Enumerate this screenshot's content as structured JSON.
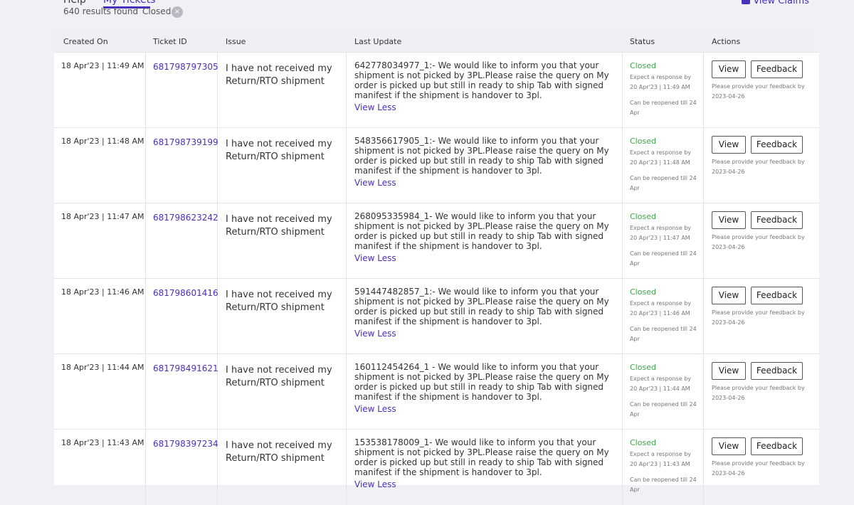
{
  "nav": {
    "tabs": [
      "Help",
      "My Tickets"
    ],
    "active_tab": "My Tickets",
    "results_text": "640 results found",
    "filter_label": "Closed",
    "filter_clear": "×",
    "claims_link": "View Claims",
    "accent_color": "#4a2fbd"
  },
  "table": {
    "headers": [
      "Created On",
      "Ticket ID",
      "Issue",
      "Last Update",
      "Status",
      "Actions"
    ],
    "view_label": "View",
    "feedback_label": "Feedback",
    "view_less_label": "View Less",
    "rows": [
      {
        "created": "18 Apr'23 | 11:49 AM",
        "ticket_id": "681798797305",
        "issue": "I have not received my Return/RTO shipment",
        "update": "642778034977_1:- We would like to inform you that your shipment is not picked by 3PL.Please raise the query on My order is picked up but still in ready to ship Tab with signed manifest if the shipment is handover to 3pl.",
        "status": "Closed",
        "expect_label": "Expect a response by",
        "expect_date": "20 Apr'23 | 11:49 AM",
        "reopen": "Can be reopened till 24 Apr",
        "feedback_note": "Please provide your feedback by 2023-04-26"
      },
      {
        "created": "18 Apr'23 | 11:48 AM",
        "ticket_id": "681798739199",
        "issue": "I have not received my Return/RTO shipment",
        "update": "548356617905_1:- We would like to inform you that your shipment is not picked by 3PL.Please raise the query on My order is picked up but still in ready to ship Tab with signed manifest if the shipment is handover to 3pl.",
        "status": "Closed",
        "expect_label": "Expect a response by",
        "expect_date": "20 Apr'23 | 11:48 AM",
        "reopen": "Can be reopened till 24 Apr",
        "feedback_note": "Please provide your feedback by 2023-04-26"
      },
      {
        "created": "18 Apr'23 | 11:47 AM",
        "ticket_id": "681798623242",
        "issue": "I have not received my Return/RTO shipment",
        "update": "268095335984_1- We would like to inform you that your shipment is not picked by 3PL.Please raise the query on My order is picked up but still in ready to ship Tab with signed manifest if the shipment is handover to 3pl.",
        "status": "Closed",
        "expect_label": "Expect a response by",
        "expect_date": "20 Apr'23 | 11:47 AM",
        "reopen": "Can be reopened till 24 Apr",
        "feedback_note": "Please provide your feedback by 2023-04-26"
      },
      {
        "created": "18 Apr'23 | 11:46 AM",
        "ticket_id": "681798601416",
        "issue": "I have not received my Return/RTO shipment",
        "update": "591447482857_1:- We would like to inform you that your shipment is not picked by 3PL.Please raise the query on My order is picked up but still in ready to ship Tab with signed manifest if the shipment is handover to 3pl.",
        "status": "Closed",
        "expect_label": "Expect a response by",
        "expect_date": "20 Apr'23 | 11:46 AM",
        "reopen": "Can be reopened till 24 Apr",
        "feedback_note": "Please provide your feedback by 2023-04-26"
      },
      {
        "created": "18 Apr'23 | 11:44 AM",
        "ticket_id": "681798491621",
        "issue": "I have not received my Return/RTO shipment",
        "update": "160112454264_1 - We would like to inform you that your shipment is not picked by 3PL.Please raise the query on My order is picked up but still in ready to ship Tab with signed manifest if the shipment is handover to 3pl.",
        "status": "Closed",
        "expect_label": "Expect a response by",
        "expect_date": "20 Apr'23 | 11:44 AM",
        "reopen": "Can be reopened till 24 Apr",
        "feedback_note": "Please provide your feedback by 2023-04-26"
      },
      {
        "created": "18 Apr'23 | 11:43 AM",
        "ticket_id": "681798397234",
        "issue": "I have not received my Return/RTO shipment",
        "update": "153538178009_1- We would like to inform you that your shipment is not picked by 3PL.Please raise the query on My order is picked up but still in ready to ship Tab with signed manifest if the shipment is handover to 3pl.",
        "status": "Closed",
        "expect_label": "Expect a response by",
        "expect_date": "20 Apr'23 | 11:43 AM",
        "reopen": "Can be reopened till 24 Apr",
        "feedback_note": "Please provide your feedback by 2023-04-26"
      }
    ]
  }
}
